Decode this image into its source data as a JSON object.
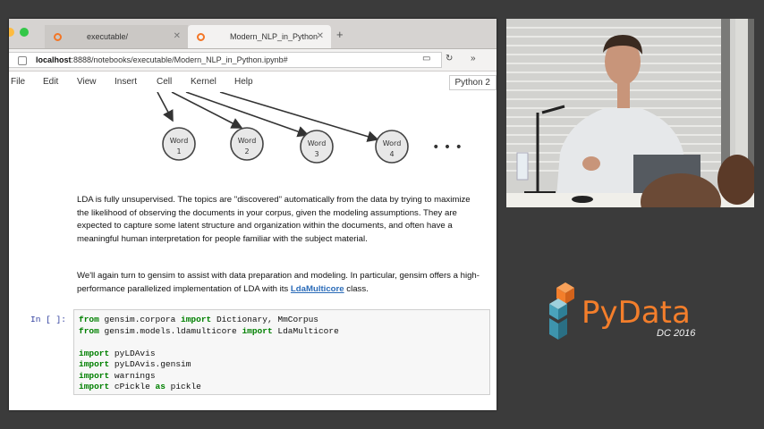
{
  "browser": {
    "tabs": [
      {
        "label": "executable/",
        "active": false
      },
      {
        "label": "Modern_NLP_in_Python",
        "active": true
      }
    ],
    "url_host": "localhost",
    "url_rest": ":8888/notebooks/executable/Modern_NLP_in_Python.ipynb#"
  },
  "menu": {
    "items": [
      "File",
      "Edit",
      "View",
      "Insert",
      "Cell",
      "Kernel",
      "Help"
    ],
    "kernel": "Python 2"
  },
  "diagram": {
    "words": [
      "Word 1",
      "Word 2",
      "Word 3",
      "Word 4"
    ],
    "ellipsis": "• • •"
  },
  "markdown": {
    "p1": "LDA is fully unsupervised. The topics are \"discovered\" automatically from the data by trying to maximize the likelihood of observing the documents in your corpus, given the modeling assumptions. They are expected to capture some latent structure and organization within the documents, and often have a meaningful human interpretation for people familiar with the subject material.",
    "p2_before": "We'll again turn to gensim to assist with data preparation and modeling. In particular, gensim offers a high-performance parallelized implementation of LDA with its ",
    "p2_link": "LdaMulticore",
    "p2_after": " class."
  },
  "cell": {
    "prompt": "In [ ]:",
    "lines": [
      [
        {
          "k": "from"
        },
        {
          "t": " gensim.corpora "
        },
        {
          "k": "import"
        },
        {
          "t": " Dictionary, MmCorpus"
        }
      ],
      [
        {
          "k": "from"
        },
        {
          "t": " gensim.models.ldamulticore "
        },
        {
          "k": "import"
        },
        {
          "t": " LdaMulticore"
        }
      ],
      [],
      [
        {
          "k": "import"
        },
        {
          "t": " pyLDAvis"
        }
      ],
      [
        {
          "k": "import"
        },
        {
          "t": " pyLDAvis.gensim"
        }
      ],
      [
        {
          "k": "import"
        },
        {
          "t": " warnings"
        }
      ],
      [
        {
          "k": "import"
        },
        {
          "t": " cPickle "
        },
        {
          "k": "as"
        },
        {
          "t": " pickle"
        }
      ]
    ]
  },
  "logo": {
    "text": "PyData",
    "sub": "DC 2016",
    "color": "#f37e2b"
  }
}
